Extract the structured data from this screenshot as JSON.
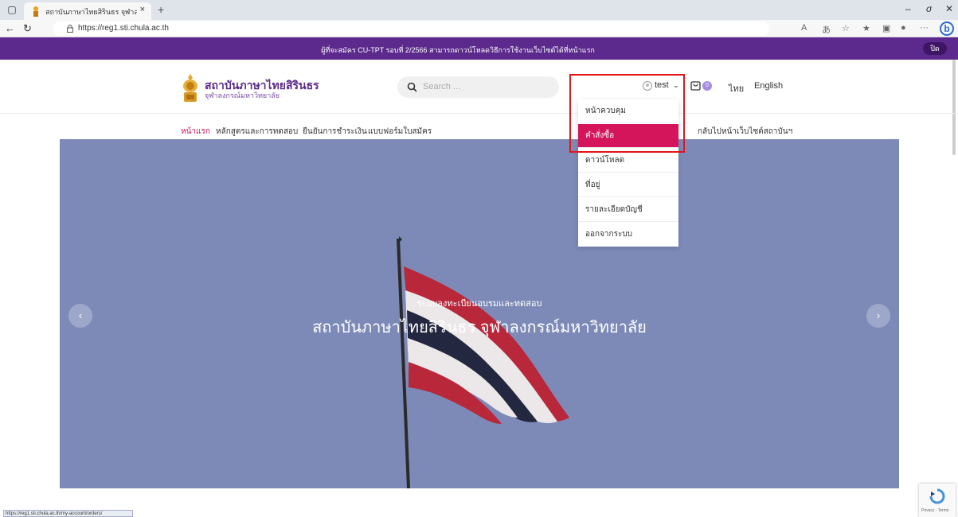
{
  "browser": {
    "tab_title": "สถาบันภาษาไทยสิรินธร จุฬาลงกรณ์ม",
    "url": "https://reg1.sti.chula.ac.th",
    "new_tab": "+",
    "tab_close": "×"
  },
  "announcement": {
    "text": "ผู้ที่จะสมัคร CU-TPT รอบที่ 2/2566 สามารถดาวน์โหลดวิธีการใช้งานเว็บไซต์ได้ที่หน้าแรก",
    "close_label": "ปิด"
  },
  "header": {
    "logo_name": "สถาบันภาษาไทยสิรินธร",
    "logo_sub": "จุฬาลงกรณ์มหาวิทยาลัย",
    "search_placeholder": "Search ...",
    "username": "test",
    "cart_count": "0",
    "lang_thai": "ไทย",
    "lang_english": "English"
  },
  "nav": {
    "items": [
      {
        "label": "หน้าแรก",
        "active": true
      },
      {
        "label": "หลักสูตรและการทดสอบ",
        "active": false
      },
      {
        "label": "ยืนยันการชำระเงิน",
        "active": false
      },
      {
        "label": "แบบฟอร์มใบสมัคร",
        "active": false
      }
    ],
    "back_link": "กลับไปหน้าเว็บไซต์สถาบันฯ"
  },
  "user_menu": {
    "items": [
      {
        "label": "หน้าควบคุม",
        "active": false
      },
      {
        "label": "คำสั่งซื้อ",
        "active": true
      },
      {
        "label": "ดาวน์โหลด",
        "active": false
      },
      {
        "label": "ที่อยู่",
        "active": false
      },
      {
        "label": "รายละเอียดบัญชี",
        "active": false
      },
      {
        "label": "ออกจากระบบ",
        "active": false
      }
    ]
  },
  "hero": {
    "subtitle": "ระบบลงทะเบียนอบรมและทดสอบ",
    "title": "สถาบันภาษาไทยสิรินธร จุฬาลงกรณ์มหาวิทยาลัย"
  },
  "recaptcha": {
    "text": "Privacy - Terms"
  },
  "status_bar": {
    "text": "https://reg1.sti.chula.ac.th/my-account/orders/"
  },
  "colors": {
    "brand_purple": "#5b2a8c",
    "accent_pink": "#d4155b",
    "highlight_red": "#e1141a"
  }
}
